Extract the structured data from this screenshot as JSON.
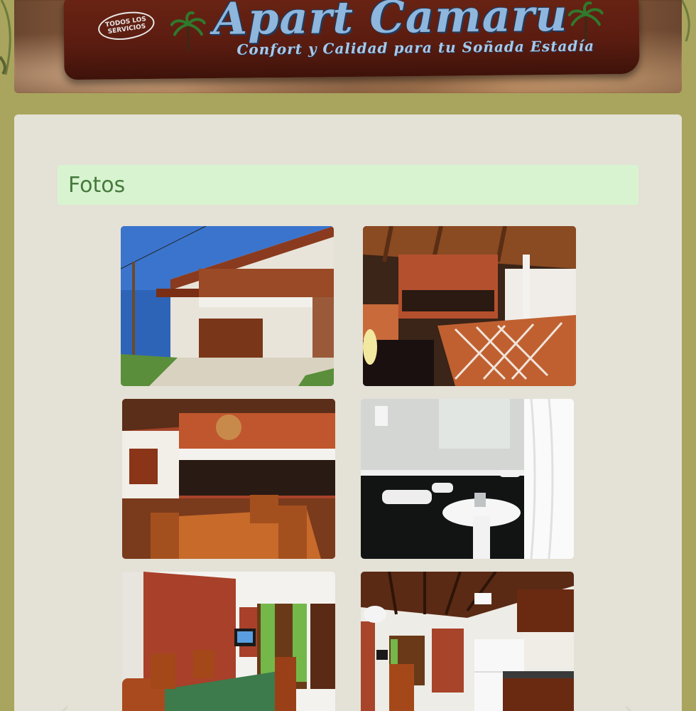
{
  "header": {
    "badge_text": "TODOS LOS SERVICIOS",
    "title": "Apart Camaru",
    "subtitle": "Confort y Calidad para tu Soñada Estadía"
  },
  "gallery": {
    "heading": "Fotos",
    "photos": [
      {
        "description_icon": "building-exterior-photo"
      },
      {
        "description_icon": "covered-patio-photo"
      },
      {
        "description_icon": "dining-grill-photo"
      },
      {
        "description_icon": "bathroom-sink-photo"
      },
      {
        "description_icon": "dining-room-photo"
      },
      {
        "description_icon": "kitchen-photo"
      }
    ],
    "prev_arrow": "‹",
    "next_arrow": "›"
  },
  "colors": {
    "page_bg": "#a9a55e",
    "panel_bg": "#e4e1d6",
    "heading_bg": "#d8f3cf",
    "heading_text": "#467a3c"
  }
}
